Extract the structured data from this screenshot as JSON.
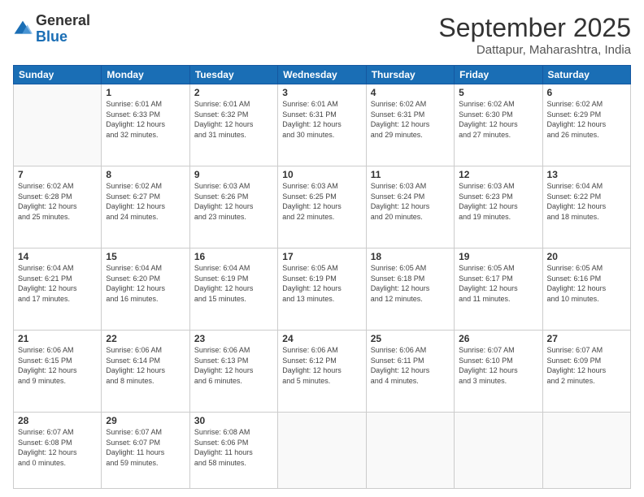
{
  "logo": {
    "general": "General",
    "blue": "Blue"
  },
  "header": {
    "month": "September 2025",
    "location": "Dattapur, Maharashtra, India"
  },
  "weekdays": [
    "Sunday",
    "Monday",
    "Tuesday",
    "Wednesday",
    "Thursday",
    "Friday",
    "Saturday"
  ],
  "weeks": [
    [
      {
        "day": "",
        "info": ""
      },
      {
        "day": "1",
        "info": "Sunrise: 6:01 AM\nSunset: 6:33 PM\nDaylight: 12 hours\nand 32 minutes."
      },
      {
        "day": "2",
        "info": "Sunrise: 6:01 AM\nSunset: 6:32 PM\nDaylight: 12 hours\nand 31 minutes."
      },
      {
        "day": "3",
        "info": "Sunrise: 6:01 AM\nSunset: 6:31 PM\nDaylight: 12 hours\nand 30 minutes."
      },
      {
        "day": "4",
        "info": "Sunrise: 6:02 AM\nSunset: 6:31 PM\nDaylight: 12 hours\nand 29 minutes."
      },
      {
        "day": "5",
        "info": "Sunrise: 6:02 AM\nSunset: 6:30 PM\nDaylight: 12 hours\nand 27 minutes."
      },
      {
        "day": "6",
        "info": "Sunrise: 6:02 AM\nSunset: 6:29 PM\nDaylight: 12 hours\nand 26 minutes."
      }
    ],
    [
      {
        "day": "7",
        "info": "Sunrise: 6:02 AM\nSunset: 6:28 PM\nDaylight: 12 hours\nand 25 minutes."
      },
      {
        "day": "8",
        "info": "Sunrise: 6:02 AM\nSunset: 6:27 PM\nDaylight: 12 hours\nand 24 minutes."
      },
      {
        "day": "9",
        "info": "Sunrise: 6:03 AM\nSunset: 6:26 PM\nDaylight: 12 hours\nand 23 minutes."
      },
      {
        "day": "10",
        "info": "Sunrise: 6:03 AM\nSunset: 6:25 PM\nDaylight: 12 hours\nand 22 minutes."
      },
      {
        "day": "11",
        "info": "Sunrise: 6:03 AM\nSunset: 6:24 PM\nDaylight: 12 hours\nand 20 minutes."
      },
      {
        "day": "12",
        "info": "Sunrise: 6:03 AM\nSunset: 6:23 PM\nDaylight: 12 hours\nand 19 minutes."
      },
      {
        "day": "13",
        "info": "Sunrise: 6:04 AM\nSunset: 6:22 PM\nDaylight: 12 hours\nand 18 minutes."
      }
    ],
    [
      {
        "day": "14",
        "info": "Sunrise: 6:04 AM\nSunset: 6:21 PM\nDaylight: 12 hours\nand 17 minutes."
      },
      {
        "day": "15",
        "info": "Sunrise: 6:04 AM\nSunset: 6:20 PM\nDaylight: 12 hours\nand 16 minutes."
      },
      {
        "day": "16",
        "info": "Sunrise: 6:04 AM\nSunset: 6:19 PM\nDaylight: 12 hours\nand 15 minutes."
      },
      {
        "day": "17",
        "info": "Sunrise: 6:05 AM\nSunset: 6:19 PM\nDaylight: 12 hours\nand 13 minutes."
      },
      {
        "day": "18",
        "info": "Sunrise: 6:05 AM\nSunset: 6:18 PM\nDaylight: 12 hours\nand 12 minutes."
      },
      {
        "day": "19",
        "info": "Sunrise: 6:05 AM\nSunset: 6:17 PM\nDaylight: 12 hours\nand 11 minutes."
      },
      {
        "day": "20",
        "info": "Sunrise: 6:05 AM\nSunset: 6:16 PM\nDaylight: 12 hours\nand 10 minutes."
      }
    ],
    [
      {
        "day": "21",
        "info": "Sunrise: 6:06 AM\nSunset: 6:15 PM\nDaylight: 12 hours\nand 9 minutes."
      },
      {
        "day": "22",
        "info": "Sunrise: 6:06 AM\nSunset: 6:14 PM\nDaylight: 12 hours\nand 8 minutes."
      },
      {
        "day": "23",
        "info": "Sunrise: 6:06 AM\nSunset: 6:13 PM\nDaylight: 12 hours\nand 6 minutes."
      },
      {
        "day": "24",
        "info": "Sunrise: 6:06 AM\nSunset: 6:12 PM\nDaylight: 12 hours\nand 5 minutes."
      },
      {
        "day": "25",
        "info": "Sunrise: 6:06 AM\nSunset: 6:11 PM\nDaylight: 12 hours\nand 4 minutes."
      },
      {
        "day": "26",
        "info": "Sunrise: 6:07 AM\nSunset: 6:10 PM\nDaylight: 12 hours\nand 3 minutes."
      },
      {
        "day": "27",
        "info": "Sunrise: 6:07 AM\nSunset: 6:09 PM\nDaylight: 12 hours\nand 2 minutes."
      }
    ],
    [
      {
        "day": "28",
        "info": "Sunrise: 6:07 AM\nSunset: 6:08 PM\nDaylight: 12 hours\nand 0 minutes."
      },
      {
        "day": "29",
        "info": "Sunrise: 6:07 AM\nSunset: 6:07 PM\nDaylight: 11 hours\nand 59 minutes."
      },
      {
        "day": "30",
        "info": "Sunrise: 6:08 AM\nSunset: 6:06 PM\nDaylight: 11 hours\nand 58 minutes."
      },
      {
        "day": "",
        "info": ""
      },
      {
        "day": "",
        "info": ""
      },
      {
        "day": "",
        "info": ""
      },
      {
        "day": "",
        "info": ""
      }
    ]
  ]
}
